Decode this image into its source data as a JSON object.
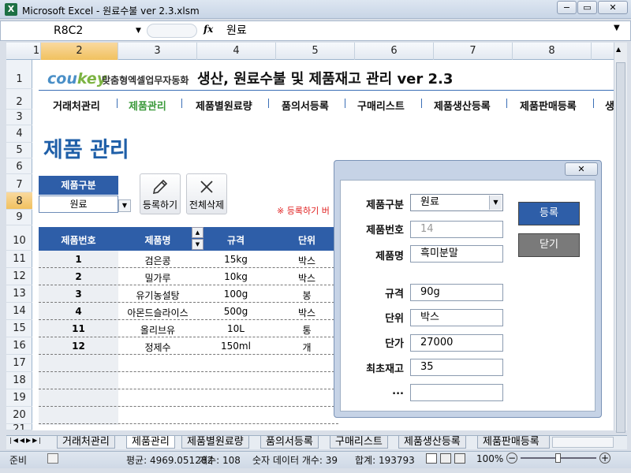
{
  "window": {
    "title": "Microsoft Excel - 원료수불 ver 2.3.xlsm",
    "app_icon": "X",
    "minimize": "−",
    "restore": "▭",
    "close": "✕"
  },
  "formula_bar": {
    "name_box": "R8C2",
    "fx": "fx",
    "value": "원료"
  },
  "columns": [
    "1",
    "2",
    "3",
    "4",
    "5",
    "6",
    "7",
    "8"
  ],
  "rows": [
    "1",
    "2",
    "3",
    "4",
    "5",
    "6",
    "7",
    "8",
    "9",
    "10",
    "11",
    "12",
    "13",
    "14",
    "15",
    "16",
    "17",
    "18",
    "19",
    "20",
    "21"
  ],
  "header": {
    "logo_main": "cou",
    "logo_accent": "key",
    "logo_sub": "맞춤형엑셀업무자동화",
    "title": "생산, 원료수불 및 제품재고 관리 ver 2.3"
  },
  "menu": [
    "거래처관리",
    "제품관리",
    "제품별원료량",
    "품의서등록",
    "구매리스트",
    "제품생산등록",
    "제품판매등록",
    "생"
  ],
  "page_title": "제품 관리",
  "category": {
    "label": "제품구분",
    "value": "원료"
  },
  "buttons": {
    "register": "등록하기",
    "delete_all": "전체삭제"
  },
  "hint": "※ 등록하기 버",
  "table": {
    "headers": [
      "제품번호",
      "제품명",
      "규격",
      "단위"
    ],
    "rows": [
      {
        "no": "1",
        "name": "검은콩",
        "spec": "15kg",
        "unit": "박스"
      },
      {
        "no": "2",
        "name": "밀가루",
        "spec": "10kg",
        "unit": "박스"
      },
      {
        "no": "3",
        "name": "유기농설탕",
        "spec": "100g",
        "unit": "봉"
      },
      {
        "no": "4",
        "name": "아몬드슬라이스",
        "spec": "500g",
        "unit": "박스"
      },
      {
        "no": "11",
        "name": "올리브유",
        "spec": "10L",
        "unit": "통"
      },
      {
        "no": "12",
        "name": "정제수",
        "spec": "150ml",
        "unit": "개"
      }
    ]
  },
  "sheet_tabs": [
    "거래처관리",
    "제품관리",
    "제품별원료량",
    "품의서등록",
    "구매리스트",
    "제품생산등록",
    "제품판매등록"
  ],
  "active_tab": "제품관리",
  "status": {
    "mode": "준비",
    "average": "평균: 4969.051282",
    "count": "개수: 108",
    "numeric_count": "숫자 데이터 개수: 39",
    "sum": "합계: 193793",
    "zoom": "100%"
  },
  "dialog": {
    "close": "✕",
    "fields": [
      {
        "label": "제품구분",
        "value": "원료"
      },
      {
        "label": "제품번호",
        "value": "14"
      },
      {
        "label": "제품명",
        "value": "흑미분말"
      },
      {
        "label": "규격",
        "value": "90g"
      },
      {
        "label": "단위",
        "value": "박스"
      },
      {
        "label": "단가",
        "value": "27000"
      },
      {
        "label": "최초재고",
        "value": "35"
      },
      {
        "label": "...",
        "value": ""
      }
    ],
    "register_button": "등록",
    "close_button": "닫기"
  },
  "colors": {
    "accent_blue": "#2e5ea8",
    "active_menu_green": "#3b9a3b",
    "hint_red": "#e01e1e"
  }
}
